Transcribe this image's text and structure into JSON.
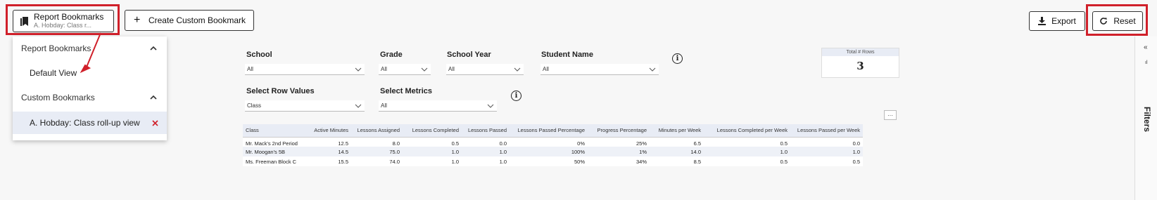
{
  "toolbar": {
    "bookmarks_label": "Report Bookmarks",
    "bookmarks_sub": "A. Hobday: Class r...",
    "create_label": "Create Custom Bookmark",
    "export_label": "Export",
    "reset_label": "Reset"
  },
  "dropdown": {
    "report_header": "Report Bookmarks",
    "report_items": [
      "Default View"
    ],
    "custom_header": "Custom Bookmarks",
    "custom_items": [
      "A. Hobday: Class roll-up view"
    ]
  },
  "filters": {
    "school": {
      "label": "School",
      "value": "All"
    },
    "grade": {
      "label": "Grade",
      "value": "All"
    },
    "school_year": {
      "label": "School Year",
      "value": "All"
    },
    "student_name": {
      "label": "Student Name",
      "value": "All"
    },
    "row_values": {
      "label": "Select Row Values",
      "value": "Class"
    },
    "metrics": {
      "label": "Select Metrics",
      "value": "All"
    }
  },
  "total": {
    "label": "Total # Rows",
    "value": "3"
  },
  "more_label": "···",
  "table": {
    "headers": [
      "Class",
      "Active Minutes",
      "Lessons Assigned",
      "Lessons Completed",
      "Lessons Passed",
      "Lessons Passed Percentage",
      "Progress Percentage",
      "Minutes per Week",
      "Lessons Completed per Week",
      "Lessons Passed per Week"
    ],
    "rows": [
      [
        "Mr. Mack's 2nd Period",
        "12.5",
        "8.0",
        "0.5",
        "0.0",
        "0%",
        "25%",
        "6.5",
        "0.5",
        "0.0"
      ],
      [
        "Mr. Moogan's 5B",
        "14.5",
        "75.0",
        "1.0",
        "1.0",
        "100%",
        "1%",
        "14.0",
        "1.0",
        "1.0"
      ],
      [
        "Ms. Freeman Block C",
        "15.5",
        "74.0",
        "1.0",
        "1.0",
        "50%",
        "34%",
        "8.5",
        "0.5",
        "0.5"
      ]
    ]
  },
  "sidebar": {
    "filters_label": "Filters"
  },
  "colors": {
    "highlight_box": "#d0202a",
    "remove_x": "#d0202a",
    "header_bg": "#e8ecf5"
  }
}
